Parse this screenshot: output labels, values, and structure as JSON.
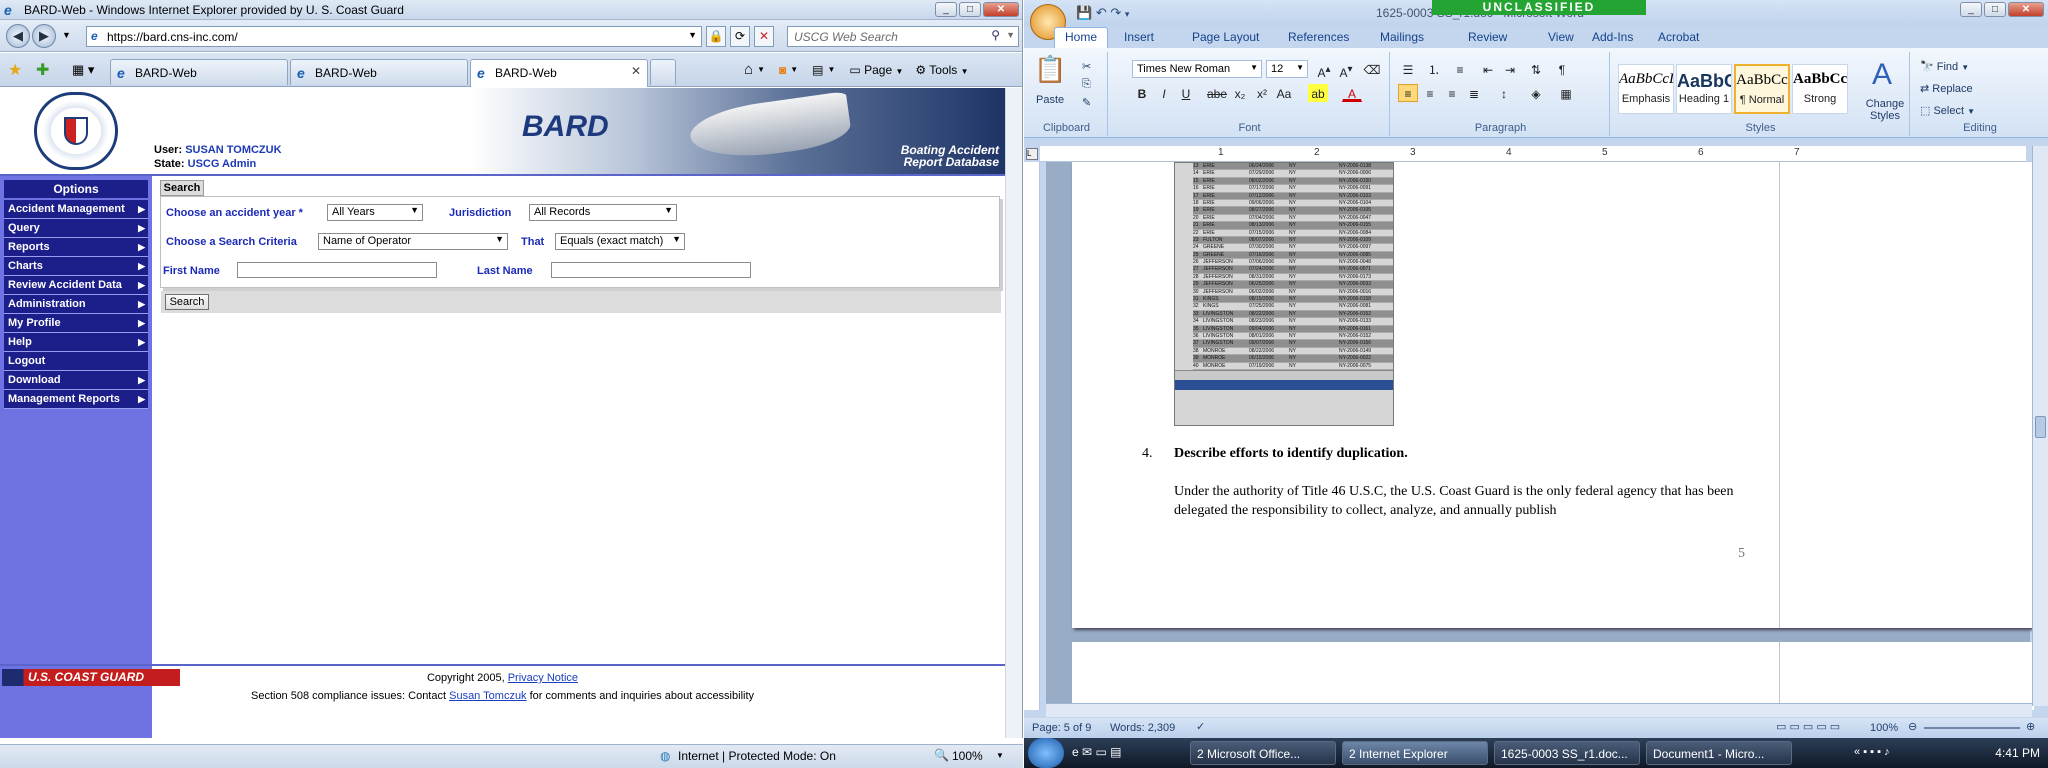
{
  "ie": {
    "title": "BARD-Web - Windows Internet Explorer provided by U. S. Coast Guard",
    "url": "https://bard.cns-inc.com/",
    "search_placeholder": "USCG Web Search",
    "tabs": [
      {
        "label": "BARD-Web"
      },
      {
        "label": "BARD-Web"
      },
      {
        "label": "BARD-Web"
      }
    ],
    "tools": {
      "page": "Page",
      "tools": "Tools"
    },
    "status": {
      "zone": "Internet | Protected Mode: On",
      "zoom": "100%"
    }
  },
  "bard": {
    "logo_text": "BARD",
    "subtitle_line1": "Boating Accident",
    "subtitle_line2": "Report Database",
    "user_label": "User:",
    "user_value": "SUSAN TOMCZUK",
    "state_label": "State:",
    "state_value": "USCG Admin",
    "options_header": "Options",
    "menu": [
      {
        "label": "Accident Management",
        "arrow": true
      },
      {
        "label": "Query",
        "arrow": true
      },
      {
        "label": "Reports",
        "arrow": true
      },
      {
        "label": "Charts",
        "arrow": true
      },
      {
        "label": "Review Accident Data",
        "arrow": true
      },
      {
        "label": "Administration",
        "arrow": true
      },
      {
        "label": "My Profile",
        "arrow": true
      },
      {
        "label": "Help",
        "arrow": true
      },
      {
        "label": "Logout",
        "arrow": false
      },
      {
        "label": "Download",
        "arrow": true
      },
      {
        "label": "Management Reports",
        "arrow": true
      }
    ],
    "search": {
      "tab": "Search",
      "year_label": "Choose an accident year *",
      "year_value": "All Years",
      "jurisdiction_label": "Jurisdiction",
      "jurisdiction_value": "All Records",
      "criteria_label": "Choose a Search Criteria",
      "criteria_value": "Name of Operator",
      "that_label": "That",
      "that_value": "Equals (exact match)",
      "first_name_label": "First Name",
      "last_name_label": "Last Name",
      "search_button": "Search"
    },
    "footer": {
      "coast_guard": "U.S. COAST GUARD",
      "copyright": "Copyright 2005,",
      "privacy": "Privacy Notice",
      "section508_pre": "Section 508 compliance issues: Contact",
      "contact": "Susan Tomczuk",
      "section508_post": "for comments and inquiries about accessibility"
    }
  },
  "word": {
    "title": "1625-0003 SS_r1.doc - Microsoft Word",
    "classification": "UNCLASSIFIED",
    "tabs": [
      "Home",
      "Insert",
      "Page Layout",
      "References",
      "Mailings",
      "Review",
      "View",
      "Add-Ins",
      "Acrobat"
    ],
    "paste": "Paste",
    "font_name": "Times New Roman",
    "font_size": "12",
    "groups": {
      "clipboard": "Clipboard",
      "font": "Font",
      "paragraph": "Paragraph",
      "styles": "Styles",
      "editing": "Editing"
    },
    "styles": [
      {
        "preview": "AaBbCcL",
        "name": "Emphasis"
      },
      {
        "preview": "AaBbC",
        "name": "Heading 1"
      },
      {
        "preview": "AaBbCc",
        "name": "¶ Normal"
      },
      {
        "preview": "AaBbCcl",
        "name": "Strong"
      }
    ],
    "change_styles": "Change Styles",
    "editing": {
      "find": "Find",
      "replace": "Replace",
      "select": "Select"
    },
    "ruler": [
      "1",
      "2",
      "3",
      "4",
      "5",
      "6",
      "7"
    ],
    "heading_num": "4.",
    "heading": "Describe efforts to identify duplication.",
    "paragraph": "Under the authority of Title 46 U.S.C, the U.S. Coast Guard is the only federal agency that has been delegated the responsibility  to collect, analyze, and annually publish",
    "page_number": "5",
    "status": {
      "page": "Page: 5 of 9",
      "words": "Words: 2,309",
      "zoom": "100%"
    },
    "embedded_rows": [
      {
        "n": "13",
        "county": "ERIE",
        "date": "06/24/2006",
        "st": "NY",
        "id": "NY-2006-0138"
      },
      {
        "n": "14",
        "county": "ERIE",
        "date": "07/29/2006",
        "st": "NY",
        "id": "NY-2006-0006"
      },
      {
        "n": "15",
        "county": "ERIE",
        "date": "08/02/2006",
        "st": "NY",
        "id": "NY-2006-0150"
      },
      {
        "n": "16",
        "county": "ERIE",
        "date": "07/17/2006",
        "st": "NY",
        "id": "NY-2006-0091"
      },
      {
        "n": "17",
        "county": "ERIE",
        "date": "07/12/2006",
        "st": "NY",
        "id": "NY-2006-0103"
      },
      {
        "n": "18",
        "county": "ERIE",
        "date": "09/06/2006",
        "st": "NY",
        "id": "NY-2006-0104"
      },
      {
        "n": "19",
        "county": "ERIE",
        "date": "08/27/2006",
        "st": "NY",
        "id": "NY-2006-0105"
      },
      {
        "n": "20",
        "county": "ERIE",
        "date": "07/04/2006",
        "st": "NY",
        "id": "NY-2006-0047"
      },
      {
        "n": "21",
        "county": "ERIE",
        "date": "08/13/2006",
        "st": "NY",
        "id": "NY-2006-0155"
      },
      {
        "n": "22",
        "county": "ERIE",
        "date": "07/15/2006",
        "st": "NY",
        "id": "NY-2006-0084"
      },
      {
        "n": "23",
        "county": "FULTON",
        "date": "08/07/2006",
        "st": "NY",
        "id": "NY-2006-0109"
      },
      {
        "n": "24",
        "county": "GREENE",
        "date": "07/30/2006",
        "st": "NY",
        "id": "NY-2006-0097"
      },
      {
        "n": "25",
        "county": "GREENE",
        "date": "07/16/2006",
        "st": "NY",
        "id": "NY-2006-0085"
      },
      {
        "n": "26",
        "county": "JEFFERSON",
        "date": "07/06/2006",
        "st": "NY",
        "id": "NY-2006-0048"
      },
      {
        "n": "27",
        "county": "JEFFERSON",
        "date": "07/24/2006",
        "st": "NY",
        "id": "NY-2006-0071"
      },
      {
        "n": "28",
        "county": "JEFFERSON",
        "date": "08/31/2006",
        "st": "NY",
        "id": "NY-2006-0173"
      },
      {
        "n": "29",
        "county": "JEFFERSON",
        "date": "06/25/2006",
        "st": "NY",
        "id": "NY-2006-0033"
      },
      {
        "n": "30",
        "county": "JEFFERSON",
        "date": "06/02/2006",
        "st": "NY",
        "id": "NY-2006-0016"
      },
      {
        "n": "31",
        "county": "KINGS",
        "date": "08/15/2006",
        "st": "NY",
        "id": "NY-2006-0158"
      },
      {
        "n": "32",
        "county": "KINGS",
        "date": "07/25/2006",
        "st": "NY",
        "id": "NY-2006-0081"
      },
      {
        "n": "33",
        "county": "LIVINGSTON",
        "date": "08/22/2006",
        "st": "NY",
        "id": "NY-2006-0152"
      },
      {
        "n": "34",
        "county": "LIVINGSTON",
        "date": "08/23/2006",
        "st": "NY",
        "id": "NY-2006-0133"
      },
      {
        "n": "35",
        "county": "LIVINGSTON",
        "date": "09/04/2006",
        "st": "NY",
        "id": "NY-2006-0161"
      },
      {
        "n": "36",
        "county": "LIVINGSTON",
        "date": "08/01/2006",
        "st": "NY",
        "id": "NY-2006-0152"
      },
      {
        "n": "37",
        "county": "LIVINGSTON",
        "date": "09/07/2006",
        "st": "NY",
        "id": "NY-2006-0166"
      },
      {
        "n": "38",
        "county": "MONROE",
        "date": "08/22/2006",
        "st": "NY",
        "id": "NY-2006-0149"
      },
      {
        "n": "39",
        "county": "MONROE",
        "date": "06/15/2006",
        "st": "NY",
        "id": "NY-2006-0022"
      },
      {
        "n": "40",
        "county": "MONROE",
        "date": "07/19/2006",
        "st": "NY",
        "id": "NY-2006-0075"
      }
    ]
  },
  "taskbar": {
    "items": [
      "2 Microsoft Office...",
      "2 Internet Explorer",
      "1625-0003 SS_r1.doc...",
      "Document1 - Micro..."
    ],
    "clock": "4:41 PM"
  }
}
